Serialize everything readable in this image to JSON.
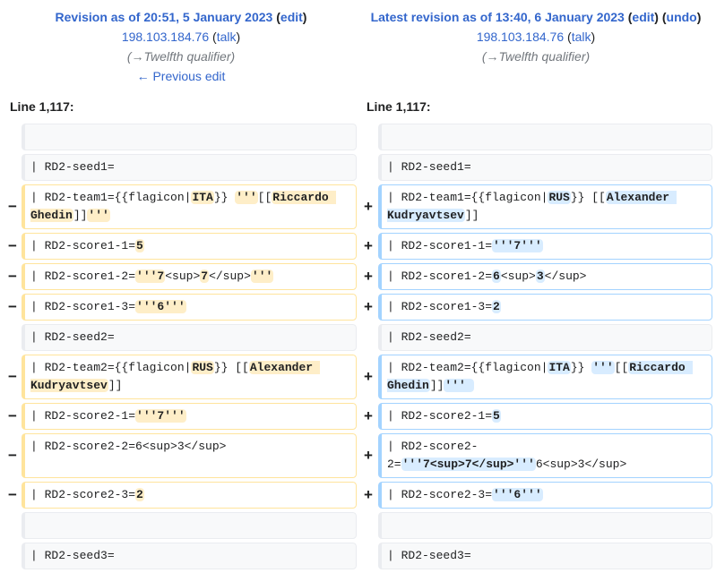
{
  "left_header": {
    "rev_prefix": "Revision as of 20:51, 5 January 2023",
    "links": [
      {
        "text": "(",
        "link": false
      },
      {
        "text": "edit",
        "link": true
      },
      {
        "text": ")",
        "link": false
      }
    ],
    "user": "198.103.184.76",
    "talk": "talk",
    "summary_arrow": "→",
    "summary_text": "Twelfth qualifier",
    "prev_edit": "← Previous edit"
  },
  "right_header": {
    "rev_prefix": "Latest revision as of 13:40, 6 January 2023",
    "links": [
      {
        "text": "(",
        "link": false
      },
      {
        "text": "edit",
        "link": true
      },
      {
        "text": ") (",
        "link": false
      },
      {
        "text": "undo",
        "link": true
      },
      {
        "text": ")",
        "link": false
      }
    ],
    "user": "198.103.184.76",
    "talk": "talk",
    "summary_arrow": "→",
    "summary_text": "Twelfth qualifier"
  },
  "line_label_left": "Line 1,117:",
  "line_label_right": "Line 1,117:",
  "markers": {
    "removed": "−",
    "added": "+"
  },
  "rows": [
    {
      "type": "context",
      "left": [],
      "right": []
    },
    {
      "type": "context",
      "left": [
        {
          "t": "| RD2-seed1="
        }
      ],
      "right": [
        {
          "t": "| RD2-seed1="
        }
      ]
    },
    {
      "type": "change",
      "left": [
        {
          "t": "| RD2-team1={{flagicon|"
        },
        {
          "t": "ITA",
          "hl": true
        },
        {
          "t": "}} "
        },
        {
          "t": "'''",
          "hl": true
        },
        {
          "t": "[["
        },
        {
          "t": "Riccardo Ghedin",
          "hl": true
        },
        {
          "t": "]]"
        },
        {
          "t": "'''",
          "hl": true
        }
      ],
      "right": [
        {
          "t": "| RD2-team1={{flagicon|"
        },
        {
          "t": "RUS",
          "hl": true
        },
        {
          "t": "}} [["
        },
        {
          "t": "Alexander Kudryavtsev",
          "hl": true
        },
        {
          "t": "]]"
        }
      ]
    },
    {
      "type": "change",
      "left": [
        {
          "t": "| RD2-score1-1="
        },
        {
          "t": "5",
          "hl": true
        }
      ],
      "right": [
        {
          "t": "| RD2-score1-1="
        },
        {
          "t": "'''7'''",
          "hl": true
        }
      ]
    },
    {
      "type": "change",
      "left": [
        {
          "t": "| RD2-score1-2="
        },
        {
          "t": "'''7",
          "hl": true
        },
        {
          "t": "<sup>"
        },
        {
          "t": "7",
          "hl": true
        },
        {
          "t": "</sup>"
        },
        {
          "t": "'''",
          "hl": true
        }
      ],
      "right": [
        {
          "t": "| RD2-score1-2="
        },
        {
          "t": "6",
          "hl": true
        },
        {
          "t": "<sup>"
        },
        {
          "t": "3",
          "hl": true
        },
        {
          "t": "</sup>"
        }
      ]
    },
    {
      "type": "change",
      "left": [
        {
          "t": "| RD2-score1-3="
        },
        {
          "t": "'''6'''",
          "hl": true
        }
      ],
      "right": [
        {
          "t": "| RD2-score1-3="
        },
        {
          "t": "2",
          "hl": true
        }
      ]
    },
    {
      "type": "context",
      "left": [
        {
          "t": "| RD2-seed2="
        }
      ],
      "right": [
        {
          "t": "| RD2-seed2="
        }
      ]
    },
    {
      "type": "change",
      "left": [
        {
          "t": "| RD2-team2={{flagicon|"
        },
        {
          "t": "RUS",
          "hl": true
        },
        {
          "t": "}} [["
        },
        {
          "t": "Alexander Kudryavtsev",
          "hl": true
        },
        {
          "t": "]]"
        }
      ],
      "right": [
        {
          "t": "| RD2-team2={{flagicon|"
        },
        {
          "t": "ITA",
          "hl": true
        },
        {
          "t": "}} "
        },
        {
          "t": "'''",
          "hl": true
        },
        {
          "t": "[["
        },
        {
          "t": "Riccardo Ghedin",
          "hl": true
        },
        {
          "t": "]]"
        },
        {
          "t": "''' ",
          "hl": true
        }
      ]
    },
    {
      "type": "change",
      "left": [
        {
          "t": "| RD2-score2-1="
        },
        {
          "t": "'''7'''",
          "hl": true
        }
      ],
      "right": [
        {
          "t": "| RD2-score2-1="
        },
        {
          "t": "5",
          "hl": true
        }
      ]
    },
    {
      "type": "change",
      "left": [
        {
          "t": "| RD2-score2-2=6<sup>3</sup>"
        }
      ],
      "right": [
        {
          "t": "| RD2-score2-2="
        },
        {
          "t": "'''7<sup>7</sup>'''",
          "hl": true
        },
        {
          "t": "6<sup>3</sup>"
        }
      ]
    },
    {
      "type": "change",
      "left": [
        {
          "t": "| RD2-score2-3="
        },
        {
          "t": "2",
          "hl": true
        }
      ],
      "right": [
        {
          "t": "| RD2-score2-3="
        },
        {
          "t": "'''6'''",
          "hl": true
        }
      ]
    },
    {
      "type": "context",
      "left": [],
      "right": []
    },
    {
      "type": "context",
      "left": [
        {
          "t": "| RD2-seed3="
        }
      ],
      "right": [
        {
          "t": "| RD2-seed3="
        }
      ]
    }
  ]
}
